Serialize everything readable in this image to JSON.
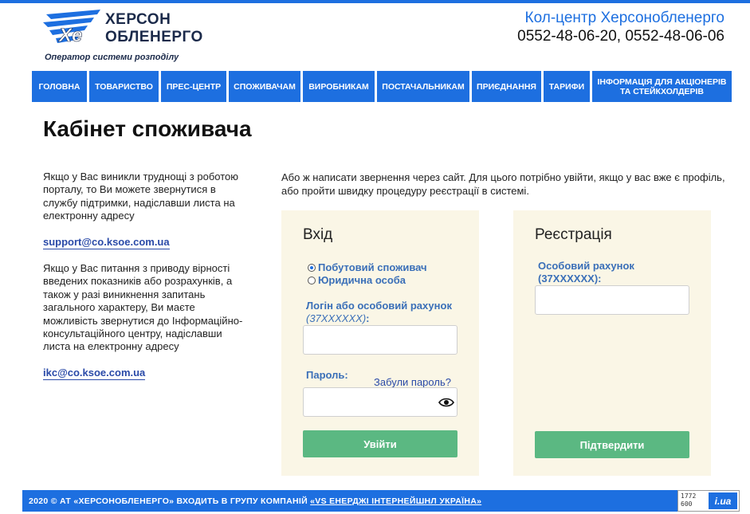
{
  "header": {
    "logo_line1": "ХЕРСОН",
    "logo_line2": "ОБЛЕНЕРГО",
    "logo_tagline": "Оператор системи розподілу",
    "callcenter_title": "Кол-центр Херсонобленерго",
    "callcenter_phones": "0552-48-06-20, 0552-48-06-06"
  },
  "nav": [
    "ГОЛОВНА",
    "ТОВАРИСТВО",
    "ПРЕС-ЦЕНТР",
    "СПОЖИВАЧАМ",
    "ВИРОБНИКАМ",
    "ПОСТАЧАЛЬНИКАМ",
    "ПРИЄДНАННЯ",
    "ТАРИФИ",
    "ІНФОРМАЦІЯ ДЛЯ АКЦІОНЕРІВ ТА СТЕЙКХОЛДЕРІВ"
  ],
  "page_title": "Кабінет споживача",
  "left": {
    "support_text": "Якщо у Вас виникли труднощі з роботою порталу, то Ви можете звернутися в службу підтримки, надіславши листа на електронну адресу",
    "support_email": "support@co.ksoe.com.ua",
    "ikc_text": "Якщо у Вас питання з приводу вірності введених показників або розрахунків, а також у разі виникнення запитань загального характеру, Ви маєте можливість звернутися до Інформаційно-консультаційного центру, надіславши листа на електронну адресу",
    "ikc_email": "ikc@co.ksoe.com.ua"
  },
  "intro": "Або ж написати звернення через сайт. Для цього потрібно увійти, якщо у вас вже є профіль, або пройти швидку процедуру реєстрації в системі.",
  "login": {
    "title": "Вхід",
    "radio_household": "Побутовий споживач",
    "radio_legal": "Юридична особа",
    "login_label": "Логін або особовий рахунок",
    "login_hint": "(37XXXXXX)",
    "login_colon": ":",
    "login_value": "",
    "password_label": "Пароль:",
    "forgot_link": "Забули пароль?",
    "password_value": "",
    "submit": "Увійти"
  },
  "register": {
    "title": "Реєстрація",
    "account_label": "Особовий рахунок (37XXXXXX):",
    "account_value": "",
    "submit": "Підтвердити"
  },
  "footer": {
    "text": "2020 © АТ «ХЕРСОНОБЛЕНЕРГО» ВХОДИТЬ В ГРУПУ КОМПАНІЙ ",
    "group_link": "«VS ЕНЕРДЖІ ІНТЕРНЕЙШНЛ УКРАЇНА»",
    "counter_top": "1772",
    "counter_bottom": "600",
    "counter_logo": "i.ua"
  },
  "colors": {
    "brand_blue": "#1d6fe0",
    "panel_bg": "#faf6e6",
    "button_green": "#5bb882",
    "label_blue": "#3a6fb8"
  }
}
